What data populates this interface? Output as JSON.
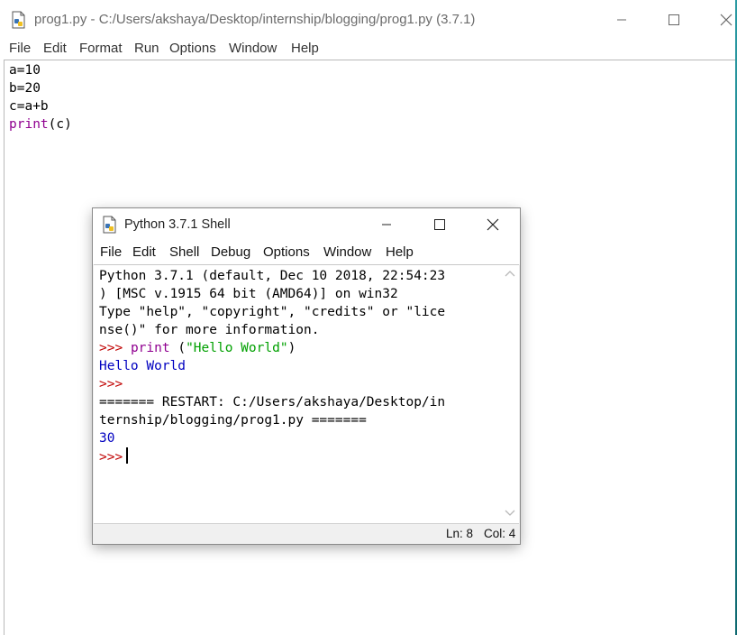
{
  "editor": {
    "title": "prog1.py - C:/Users/akshaya/Desktop/internship/blogging/prog1.py (3.7.1)",
    "menu": [
      "File",
      "Edit",
      "Format",
      "Run",
      "Options",
      "Window",
      "Help"
    ],
    "code_lines": [
      {
        "plain": "a=10"
      },
      {
        "plain": "b=20"
      },
      {
        "plain": "c=a+b"
      },
      {
        "keyword": "print",
        "rest": "(c)"
      }
    ],
    "icons": {
      "app": "python-file-icon",
      "minimize": "minimize-icon",
      "maximize": "maximize-icon",
      "close": "close-icon"
    }
  },
  "shell": {
    "title": "Python 3.7.1 Shell",
    "menu": [
      "File",
      "Edit",
      "Shell",
      "Debug",
      "Options",
      "Window",
      "Help"
    ],
    "lines": {
      "l1": "Python 3.7.1 (default, Dec 10 2018, 22:54:23",
      "l2": ") [MSC v.1915 64 bit (AMD64)] on win32",
      "l3": "Type \"help\", \"copyright\", \"credits\" or \"lice",
      "l4": "nse()\" for more information.",
      "prompt": ">>>",
      "l5_kw": "print",
      "l5_open": " (",
      "l5_str": "\"Hello World\"",
      "l5_close": ")",
      "l6": "Hello World",
      "l8": "======= RESTART: C:/Users/akshaya/Desktop/in",
      "l9": "ternship/blogging/prog1.py =======",
      "l10": "30"
    },
    "status": {
      "line": "Ln: 8",
      "col": "Col: 4"
    }
  },
  "colors": {
    "prompt": "#c00000",
    "keyword": "#900090",
    "string": "#00a000",
    "output": "#0000c0"
  }
}
